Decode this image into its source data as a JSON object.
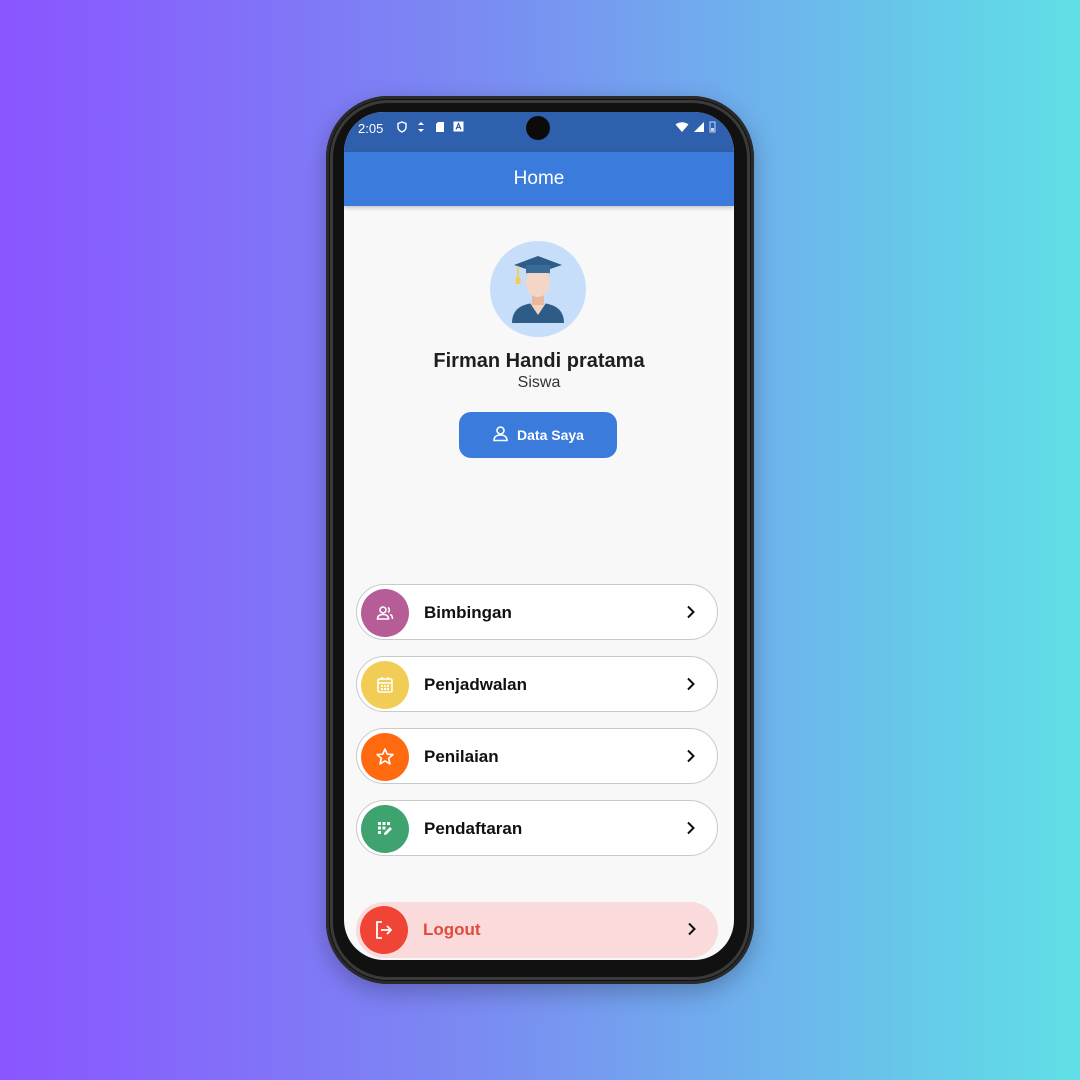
{
  "status_bar": {
    "time": "2:05"
  },
  "appbar": {
    "title": "Home"
  },
  "profile": {
    "name": "Firman Handi pratama",
    "role": "Siswa",
    "data_button_label": "Data Saya"
  },
  "menu": [
    {
      "label": "Bimbingan",
      "icon": "people-icon",
      "color": "#b65c97"
    },
    {
      "label": "Penjadwalan",
      "icon": "calendar-icon",
      "color": "#f2cd55"
    },
    {
      "label": "Penilaian",
      "icon": "star-icon",
      "color": "#ff6a10"
    },
    {
      "label": "Pendaftaran",
      "icon": "edit-grid-icon",
      "color": "#3fa36f"
    }
  ],
  "logout": {
    "label": "Logout",
    "icon": "logout-icon",
    "color": "#f04437",
    "background": "#fadada"
  },
  "colors": {
    "primary": "#3a7bdc",
    "statusbar": "#2f60ad",
    "screen_bg": "#f8f8f8"
  }
}
